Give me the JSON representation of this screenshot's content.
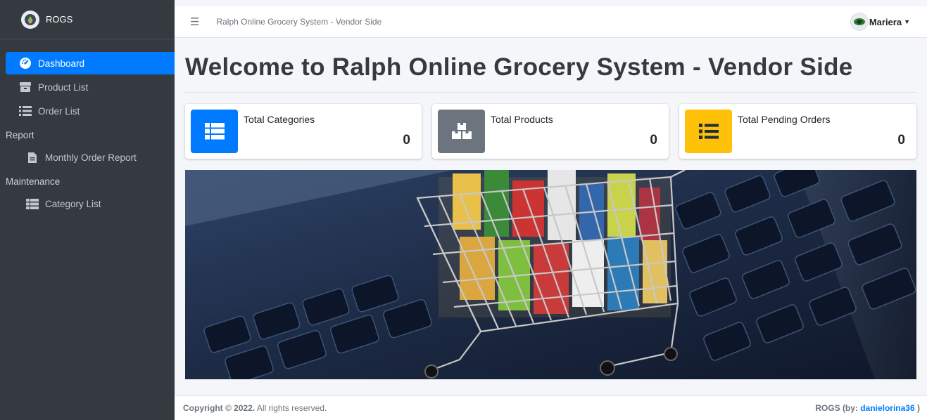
{
  "brand": {
    "name": "ROGS"
  },
  "sidebar": {
    "items": [
      {
        "label": "Dashboard",
        "icon": "tachometer-icon",
        "active": true
      },
      {
        "label": "Product List",
        "icon": "box-icon"
      },
      {
        "label": "Order List",
        "icon": "list-icon"
      }
    ],
    "report_header": "Report",
    "report_items": [
      {
        "label": "Monthly Order Report",
        "icon": "file-icon"
      }
    ],
    "maintenance_header": "Maintenance",
    "maintenance_items": [
      {
        "label": "Category List",
        "icon": "table-icon"
      }
    ]
  },
  "topbar": {
    "title": "Ralph Online Grocery System - Vendor Side",
    "username": "Mariera"
  },
  "page": {
    "title": "Welcome to Ralph Online Grocery System - Vendor Side"
  },
  "stats": [
    {
      "label": "Total Categories",
      "value": "0",
      "color": "#007bff",
      "icon": "th-list-icon"
    },
    {
      "label": "Total Products",
      "value": "0",
      "color": "#6c757d",
      "icon": "boxes-icon"
    },
    {
      "label": "Total Pending Orders",
      "value": "0",
      "color": "#ffc107",
      "icon": "list-icon"
    }
  ],
  "footer": {
    "copyright_bold": "Copyright © 2022.",
    "copyright_rest": " All rights reserved.",
    "credit_prefix": "ROGS (by: ",
    "credit_author": "danielorina36",
    "credit_suffix": " )"
  }
}
